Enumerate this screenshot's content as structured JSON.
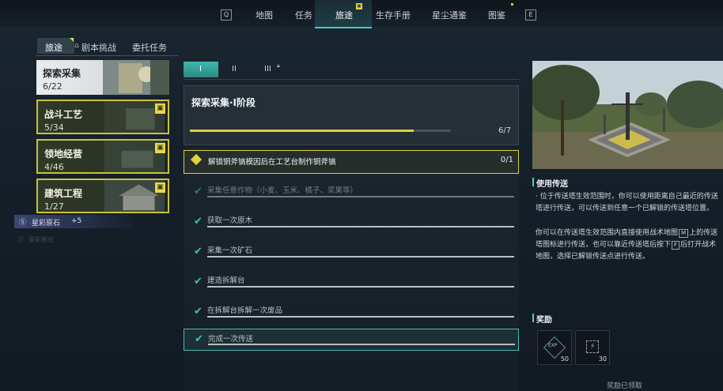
{
  "nav": {
    "key_left": "Q",
    "key_right": "E",
    "tabs": [
      "地图",
      "任务",
      "旅途",
      "生存手册",
      "星尘通鉴",
      "图鉴"
    ],
    "active_tab": "旅途"
  },
  "subtabs": {
    "items": [
      "旅途",
      "剧本挑战",
      "委托任务"
    ],
    "active": "旅途"
  },
  "categories": [
    {
      "title": "探索采集",
      "count": "6/22",
      "style": "selected"
    },
    {
      "title": "战斗工艺",
      "count": "5/34",
      "style": "gold",
      "badge": "gift-icon"
    },
    {
      "title": "领地经营",
      "count": "4/46",
      "style": "gold",
      "badge": "gift-icon"
    },
    {
      "title": "建筑工程",
      "count": "1/27",
      "style": "gold",
      "badge": "gift-icon"
    }
  ],
  "reward_note": {
    "label": "星彩原石",
    "amount": "+5"
  },
  "faded_note": "星彩原石",
  "phases": [
    "I",
    "II",
    "III"
  ],
  "quest": {
    "title": "探索采集·I阶段",
    "progress_text": "6/7",
    "progress": 0.857,
    "tasks": [
      {
        "label": "解锁铜斧镐模因后在工艺台制作铜斧镐",
        "count": "0/1",
        "state": "active"
      },
      {
        "label": "采集任意作物（小麦、玉米、橘子、浆果等）",
        "state": "done"
      },
      {
        "label": "获取一次原木",
        "state": "done"
      },
      {
        "label": "采集一次矿石",
        "state": "done"
      },
      {
        "label": "建造拆解台",
        "state": "done"
      },
      {
        "label": "在拆解台拆解一次废品",
        "state": "done"
      },
      {
        "label": "完成一次传送",
        "state": "done-highlight"
      }
    ]
  },
  "detail": {
    "heading": "使用传送",
    "para1": "· 位于传送塔生效范围时，你可以使用距离自己最近的传送塔进行传送，可以传送到任意一个已解锁的传送塔位置。",
    "para2_a": "你可以在传送塔生效范围内直接使用战术地图",
    "key_m": "M",
    "para2_b": "上的传送塔图标进行传送，也可以靠近传送塔后按下",
    "key_f": "F",
    "para2_c": "后打开战术地图，选择已解锁传送点进行传送。",
    "rewards_heading": "奖励",
    "rewards": [
      {
        "icon": "exp-icon",
        "label": "EXP",
        "amount": "50"
      },
      {
        "icon": "stardust-icon",
        "amount": "30"
      }
    ],
    "claimed": "奖励已领取"
  },
  "colors": {
    "accent": "#48c9c0",
    "gold": "#e2cf3e",
    "check": "#3fc4b3"
  }
}
